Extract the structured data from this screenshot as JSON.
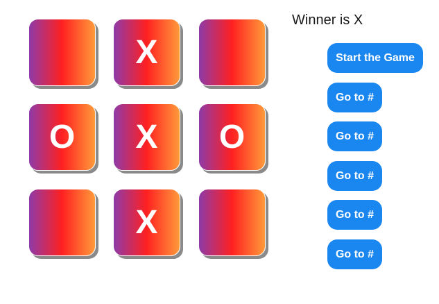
{
  "status": {
    "text": "Winner is X"
  },
  "board": {
    "cells": [
      "",
      "X",
      "",
      "O",
      "X",
      "O",
      "",
      "X",
      ""
    ],
    "colors": {
      "gradient_start": "#8e3aa8",
      "gradient_mid": "#ff2020",
      "gradient_end": "#ff9a3a",
      "mark": "#ffffff",
      "shadow": "#8a8a8a"
    }
  },
  "history": {
    "start_label": "Start the Game",
    "moves": [
      "Go to #",
      "Go to #",
      "Go to #",
      "Go to #",
      "Go to #"
    ],
    "button_color": "#1a86f0"
  }
}
